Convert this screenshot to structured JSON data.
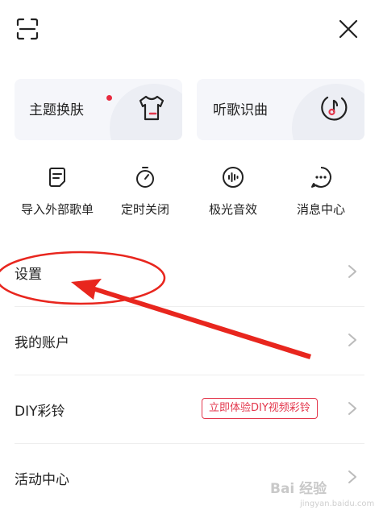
{
  "header": {
    "scan_icon": "scan-icon",
    "close_icon": "close-icon"
  },
  "cards": [
    {
      "label": "主题换肤",
      "icon": "tshirt-icon",
      "has_dot": true
    },
    {
      "label": "听歌识曲",
      "icon": "music-recognize-icon",
      "has_dot": false
    }
  ],
  "quick_actions": [
    {
      "label": "导入外部歌单",
      "icon": "import-playlist-icon"
    },
    {
      "label": "定时关闭",
      "icon": "timer-icon"
    },
    {
      "label": "极光音效",
      "icon": "sound-effect-icon"
    },
    {
      "label": "消息中心",
      "icon": "message-icon"
    }
  ],
  "rows": [
    {
      "label": "设置"
    },
    {
      "label": "我的账户"
    },
    {
      "label": "DIY彩铃",
      "promo": "立即体验DIY视频彩铃"
    },
    {
      "label": "活动中心"
    }
  ],
  "watermark": {
    "text": "Bai 经验",
    "sub": "jingyan.baidu.com"
  },
  "colors": {
    "accent": "#e3374c",
    "card_bg": "#f5f6fa",
    "annotation": "#e8261e"
  }
}
